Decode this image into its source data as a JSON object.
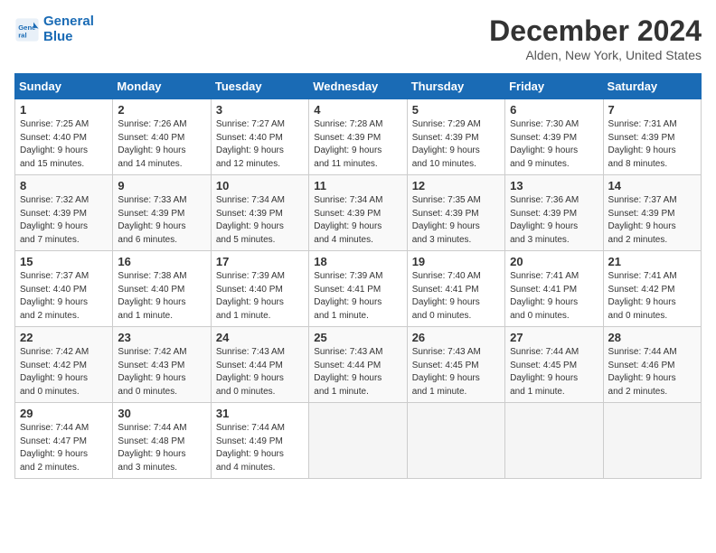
{
  "logo": {
    "line1": "General",
    "line2": "Blue"
  },
  "title": "December 2024",
  "subtitle": "Alden, New York, United States",
  "days_of_week": [
    "Sunday",
    "Monday",
    "Tuesday",
    "Wednesday",
    "Thursday",
    "Friday",
    "Saturday"
  ],
  "weeks": [
    [
      {
        "day": 1,
        "info": "Sunrise: 7:25 AM\nSunset: 4:40 PM\nDaylight: 9 hours\nand 15 minutes."
      },
      {
        "day": 2,
        "info": "Sunrise: 7:26 AM\nSunset: 4:40 PM\nDaylight: 9 hours\nand 14 minutes."
      },
      {
        "day": 3,
        "info": "Sunrise: 7:27 AM\nSunset: 4:40 PM\nDaylight: 9 hours\nand 12 minutes."
      },
      {
        "day": 4,
        "info": "Sunrise: 7:28 AM\nSunset: 4:39 PM\nDaylight: 9 hours\nand 11 minutes."
      },
      {
        "day": 5,
        "info": "Sunrise: 7:29 AM\nSunset: 4:39 PM\nDaylight: 9 hours\nand 10 minutes."
      },
      {
        "day": 6,
        "info": "Sunrise: 7:30 AM\nSunset: 4:39 PM\nDaylight: 9 hours\nand 9 minutes."
      },
      {
        "day": 7,
        "info": "Sunrise: 7:31 AM\nSunset: 4:39 PM\nDaylight: 9 hours\nand 8 minutes."
      }
    ],
    [
      {
        "day": 8,
        "info": "Sunrise: 7:32 AM\nSunset: 4:39 PM\nDaylight: 9 hours\nand 7 minutes."
      },
      {
        "day": 9,
        "info": "Sunrise: 7:33 AM\nSunset: 4:39 PM\nDaylight: 9 hours\nand 6 minutes."
      },
      {
        "day": 10,
        "info": "Sunrise: 7:34 AM\nSunset: 4:39 PM\nDaylight: 9 hours\nand 5 minutes."
      },
      {
        "day": 11,
        "info": "Sunrise: 7:34 AM\nSunset: 4:39 PM\nDaylight: 9 hours\nand 4 minutes."
      },
      {
        "day": 12,
        "info": "Sunrise: 7:35 AM\nSunset: 4:39 PM\nDaylight: 9 hours\nand 3 minutes."
      },
      {
        "day": 13,
        "info": "Sunrise: 7:36 AM\nSunset: 4:39 PM\nDaylight: 9 hours\nand 3 minutes."
      },
      {
        "day": 14,
        "info": "Sunrise: 7:37 AM\nSunset: 4:39 PM\nDaylight: 9 hours\nand 2 minutes."
      }
    ],
    [
      {
        "day": 15,
        "info": "Sunrise: 7:37 AM\nSunset: 4:40 PM\nDaylight: 9 hours\nand 2 minutes."
      },
      {
        "day": 16,
        "info": "Sunrise: 7:38 AM\nSunset: 4:40 PM\nDaylight: 9 hours\nand 1 minute."
      },
      {
        "day": 17,
        "info": "Sunrise: 7:39 AM\nSunset: 4:40 PM\nDaylight: 9 hours\nand 1 minute."
      },
      {
        "day": 18,
        "info": "Sunrise: 7:39 AM\nSunset: 4:41 PM\nDaylight: 9 hours\nand 1 minute."
      },
      {
        "day": 19,
        "info": "Sunrise: 7:40 AM\nSunset: 4:41 PM\nDaylight: 9 hours\nand 0 minutes."
      },
      {
        "day": 20,
        "info": "Sunrise: 7:41 AM\nSunset: 4:41 PM\nDaylight: 9 hours\nand 0 minutes."
      },
      {
        "day": 21,
        "info": "Sunrise: 7:41 AM\nSunset: 4:42 PM\nDaylight: 9 hours\nand 0 minutes."
      }
    ],
    [
      {
        "day": 22,
        "info": "Sunrise: 7:42 AM\nSunset: 4:42 PM\nDaylight: 9 hours\nand 0 minutes."
      },
      {
        "day": 23,
        "info": "Sunrise: 7:42 AM\nSunset: 4:43 PM\nDaylight: 9 hours\nand 0 minutes."
      },
      {
        "day": 24,
        "info": "Sunrise: 7:43 AM\nSunset: 4:44 PM\nDaylight: 9 hours\nand 0 minutes."
      },
      {
        "day": 25,
        "info": "Sunrise: 7:43 AM\nSunset: 4:44 PM\nDaylight: 9 hours\nand 1 minute."
      },
      {
        "day": 26,
        "info": "Sunrise: 7:43 AM\nSunset: 4:45 PM\nDaylight: 9 hours\nand 1 minute."
      },
      {
        "day": 27,
        "info": "Sunrise: 7:44 AM\nSunset: 4:45 PM\nDaylight: 9 hours\nand 1 minute."
      },
      {
        "day": 28,
        "info": "Sunrise: 7:44 AM\nSunset: 4:46 PM\nDaylight: 9 hours\nand 2 minutes."
      }
    ],
    [
      {
        "day": 29,
        "info": "Sunrise: 7:44 AM\nSunset: 4:47 PM\nDaylight: 9 hours\nand 2 minutes."
      },
      {
        "day": 30,
        "info": "Sunrise: 7:44 AM\nSunset: 4:48 PM\nDaylight: 9 hours\nand 3 minutes."
      },
      {
        "day": 31,
        "info": "Sunrise: 7:44 AM\nSunset: 4:49 PM\nDaylight: 9 hours\nand 4 minutes."
      },
      null,
      null,
      null,
      null
    ]
  ]
}
